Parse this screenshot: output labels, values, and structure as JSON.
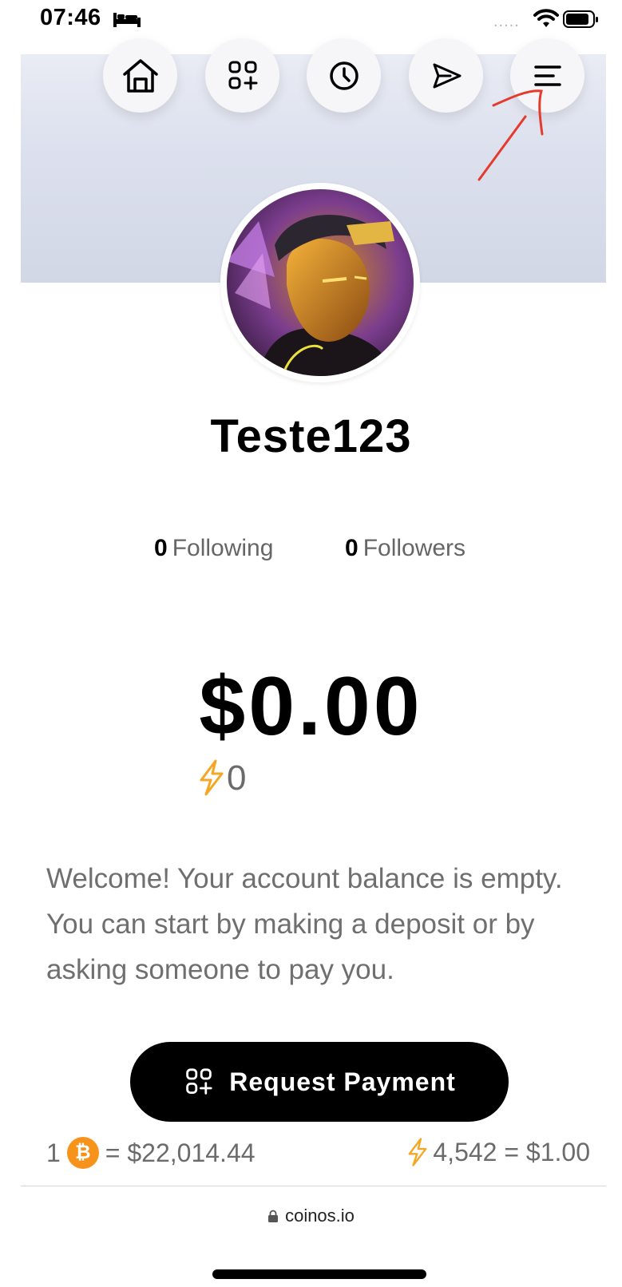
{
  "status_bar": {
    "time": "07:46",
    "signal": "....."
  },
  "nav": {
    "items": [
      {
        "name": "home",
        "icon": "home-icon"
      },
      {
        "name": "receive",
        "icon": "receive-icon"
      },
      {
        "name": "history",
        "icon": "clock-icon"
      },
      {
        "name": "send",
        "icon": "send-icon"
      },
      {
        "name": "menu",
        "icon": "menu-icon"
      }
    ]
  },
  "profile": {
    "username": "Teste123",
    "following_count": "0",
    "following_label": "Following",
    "followers_count": "0",
    "followers_label": "Followers"
  },
  "balance": {
    "fiat": "$0.00",
    "sats": "0"
  },
  "welcome_text": "Welcome! Your account balance is empty. You can start by making a deposit or by asking someone to pay you.",
  "request_button": {
    "label": "Request Payment"
  },
  "rates": {
    "btc_prefix": "1",
    "btc_symbol": "₿",
    "btc_value": "= $22,014.44",
    "sats_value": "4,542 = $1.00"
  },
  "browser": {
    "url": "coinos.io"
  },
  "colors": {
    "accent": "#f7931a",
    "bolt": "#f5a623",
    "annotation": "#e53b2c"
  }
}
